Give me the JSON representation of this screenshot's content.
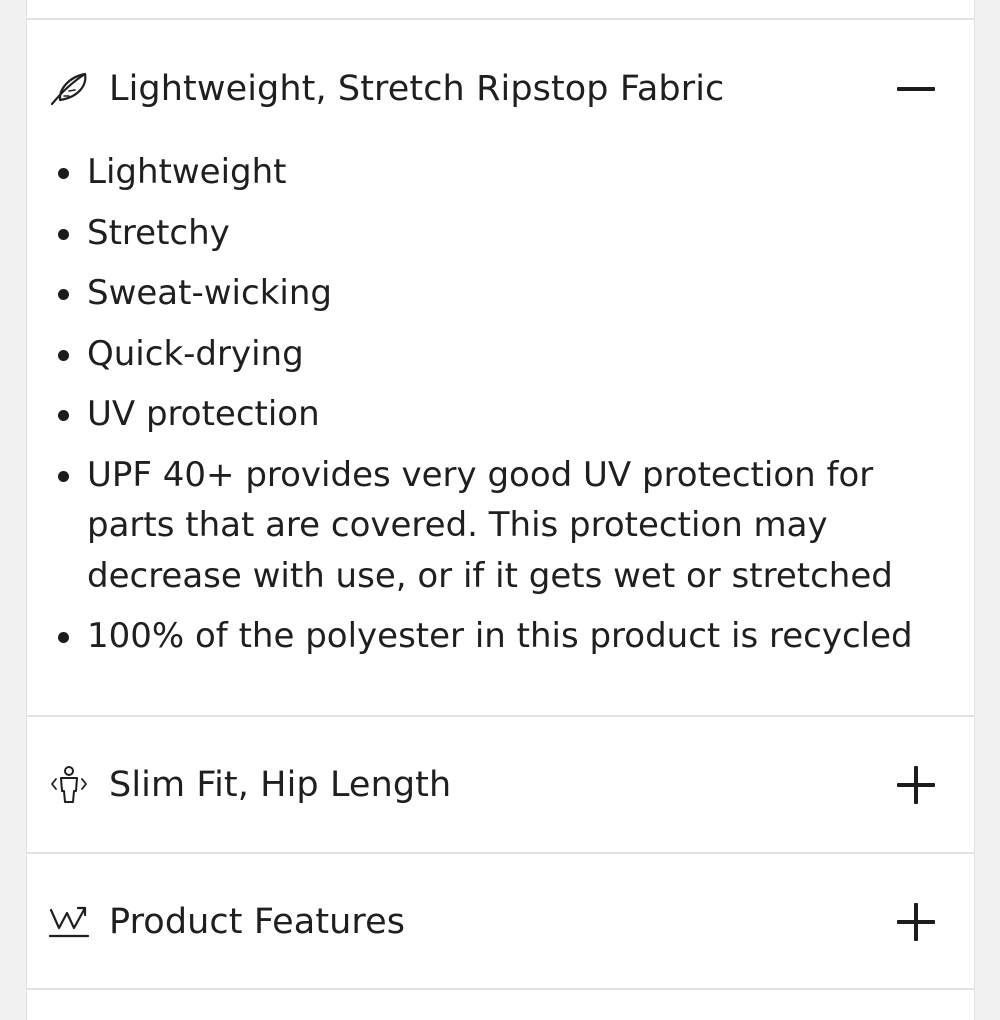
{
  "sections": [
    {
      "icon": "feather-icon",
      "title": "Lightweight, Stretch Ripstop Fabric",
      "state": "expanded",
      "toggle": "minus-icon",
      "bullets": [
        "Lightweight",
        "Stretchy",
        "Sweat-wicking",
        "Quick-drying",
        "UV protection",
        "UPF 40+ provides very good UV protection for parts that are covered. This protection may decrease with use, or if it gets wet or stretched",
        "100% of the polyester in this product is recycled"
      ]
    },
    {
      "icon": "person-fit-icon",
      "title": "Slim Fit, Hip Length",
      "state": "collapsed",
      "toggle": "plus-icon"
    },
    {
      "icon": "features-icon",
      "title": "Product Features",
      "state": "collapsed",
      "toggle": "plus-icon"
    }
  ],
  "colors": {
    "background": "#f1f1f1",
    "panel": "#ffffff",
    "text": "#1f1f1f",
    "divider": "#e3e3e3"
  }
}
